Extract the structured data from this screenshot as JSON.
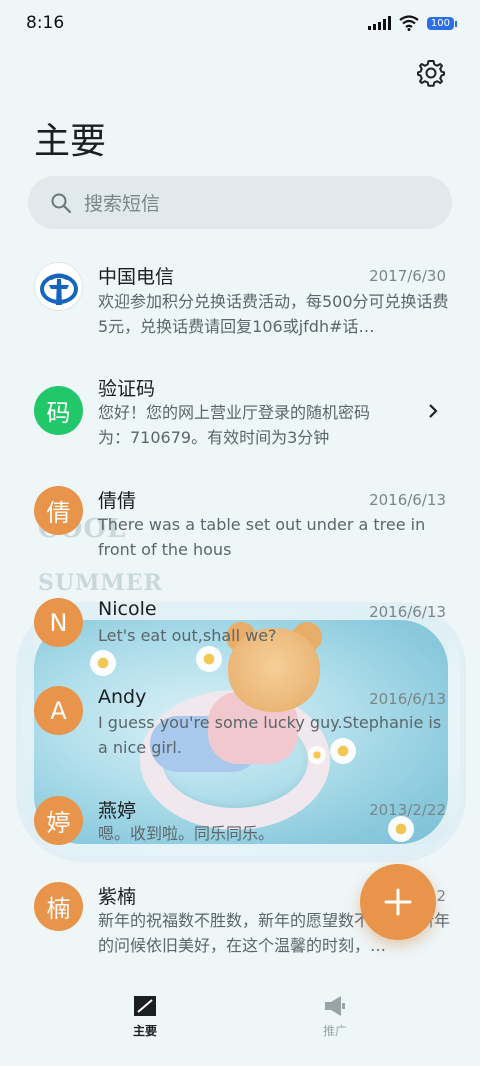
{
  "status_bar": {
    "time": "8:16",
    "battery": "100"
  },
  "header": {
    "title": "主要"
  },
  "search": {
    "placeholder": "搜索短信"
  },
  "conversations": [
    {
      "name": "中国电信",
      "date": "2017/6/30",
      "preview": "欢迎参加积分兑换话费活动，每500分可兑换话费5元，兑换话费请回复106或jfdh#话…",
      "avatar": "",
      "avatar_color": "#ffffff"
    },
    {
      "name": "验证码",
      "date": "",
      "preview": "您好！您的网上营业厅登录的随机密码为：710679。有效时间为3分钟",
      "avatar": "码",
      "avatar_color": "#22c76a"
    },
    {
      "name": "倩倩",
      "date": "2016/6/13",
      "preview": "There was a table set out under a tree in front of the hous",
      "avatar": "倩",
      "avatar_color": "#e8944a"
    },
    {
      "name": "Nicole",
      "date": "2016/6/13",
      "preview": "Let's eat out,shall we?",
      "avatar": "N",
      "avatar_color": "#e8944a"
    },
    {
      "name": "Andy",
      "date": "2016/6/13",
      "preview": "I guess you're some lucky guy.Stephanie is a nice girl.",
      "avatar": "A",
      "avatar_color": "#e8944a"
    },
    {
      "name": "燕婷",
      "date": "2013/2/22",
      "preview": "嗯。收到啦。同乐同乐。",
      "avatar": "婷",
      "avatar_color": "#e8944a"
    },
    {
      "name": "紫楠",
      "date": "2",
      "preview": "新年的祝福数不胜数，新年的愿望数不胜数，新年的问候依旧美好，在这个温馨的时刻，…",
      "avatar": "楠",
      "avatar_color": "#e8944a"
    }
  ],
  "fab": {
    "icon": "plus-icon"
  },
  "bottom_nav": [
    {
      "label": "主要",
      "icon": "chat-icon",
      "active": true
    },
    {
      "label": "推广",
      "icon": "megaphone-icon",
      "active": false
    }
  ],
  "wallpaper": {
    "text1": "COOL",
    "text2": "SUMMER"
  },
  "colors": {
    "accent": "#e8944a",
    "green": "#22c76a",
    "telecom_blue": "#1565c0"
  }
}
